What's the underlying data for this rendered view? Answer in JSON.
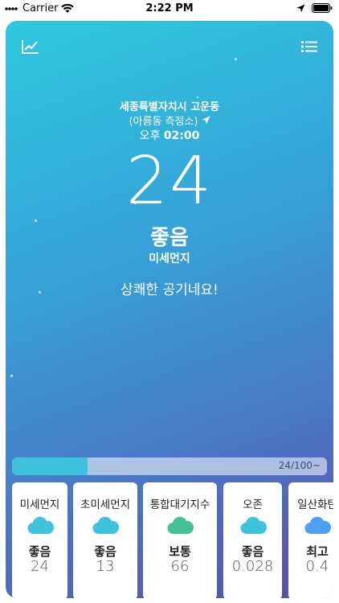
{
  "status_bar": {
    "carrier": "Carrier",
    "time": "2:22 PM"
  },
  "location": {
    "title": "세종특별자치시 고운동",
    "station": "(아름동 측정소)"
  },
  "time": {
    "period": "오후",
    "clock": "02:00"
  },
  "main": {
    "value": "24",
    "status": "좋음",
    "metric": "미세먼지",
    "message": "상쾌한 공기네요!"
  },
  "progress": {
    "text": "24/100~",
    "fraction": 0.24
  },
  "colors": {
    "good": "#3fc3dc",
    "normal": "#45c19a",
    "best": "#4d9fef"
  },
  "tiles": [
    {
      "title": "미세먼지",
      "status": "좋음",
      "value": "24",
      "icon": "cloud-icon",
      "color": "#3fc3dc"
    },
    {
      "title": "초미세먼지",
      "status": "좋음",
      "value": "13",
      "icon": "cloud-icon",
      "color": "#3fc3dc"
    },
    {
      "title": "통합대기지수",
      "status": "보통",
      "value": "66",
      "icon": "cloud-icon",
      "color": "#45c19a"
    },
    {
      "title": "오존",
      "status": "좋음",
      "value": "0.028",
      "icon": "cloud-icon",
      "color": "#3fc3dc"
    },
    {
      "title": "일산화탄",
      "status": "최고",
      "value": "0.4",
      "icon": "cloud-icon",
      "color": "#4d9fef"
    }
  ]
}
